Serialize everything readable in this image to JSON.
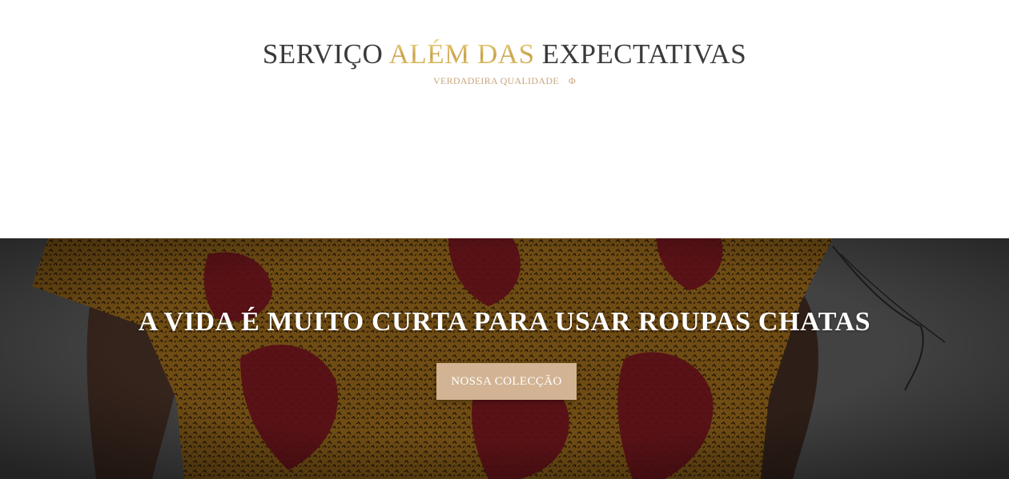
{
  "section_top": {
    "headline": {
      "part1": "SERVIÇO ",
      "accent": "ALÉM DAS",
      "part3": " EXPECTATIVAS"
    },
    "subline": {
      "text": "VERDADEIRA QUALIDADE",
      "symbol": "Φ"
    },
    "colors": {
      "headline": "#3a3a3a",
      "accent": "#c9a24a",
      "subline": "#c9a77e"
    }
  },
  "hero": {
    "title": "A VIDA É MUITO CURTA PARA USAR ROUPAS CHATAS",
    "button_label": "NOSSA COLECÇÃO",
    "colors": {
      "button": "#d2b393",
      "fabric": "#9a6a1c",
      "print": "#7a1420",
      "backdrop": "#5a5a5c"
    }
  }
}
